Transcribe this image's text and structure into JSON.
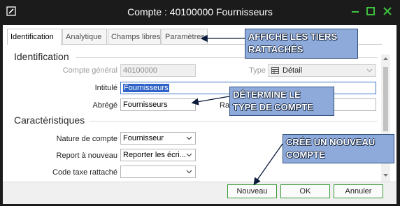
{
  "window": {
    "title": "Compte : 40100000 Fournisseurs"
  },
  "tabs": [
    {
      "label": "Identification"
    },
    {
      "label": "Analytique"
    },
    {
      "label": "Champs libres"
    },
    {
      "label": "Paramètres"
    }
  ],
  "identification": {
    "section_title": "Identification",
    "compte_general_label": "Compte général",
    "compte_general_value": "40100000",
    "type_label": "Type",
    "type_value": "Détail",
    "intitule_label": "Intitulé",
    "intitule_value": "Fournisseurs",
    "abrege_label": "Abrégé",
    "abrege_value": "Fournisseurs",
    "ra_label": "Ra"
  },
  "caracteristiques": {
    "section_title": "Caractéristiques",
    "nature_label": "Nature de compte",
    "nature_value": "Fournisseur",
    "report_label": "Report à nouveau",
    "report_value": "Reporter les écri...",
    "code_taxe_label": "Code taxe rattaché",
    "code_taxe_value": ""
  },
  "buttons": {
    "nouveau": "Nouveau",
    "ok": "OK",
    "annuler": "Annuler"
  },
  "callouts": {
    "tiers": "AFFICHE LES TIERS\nRATTACHÉS",
    "type": "DÉTERMINE LE\nTYPE DE COMPTE",
    "nouveau": "CRÉE UN NOUVEAU\nCOMPTE"
  },
  "colors": {
    "callout_fill": "#8eaadb",
    "accent_green": "#3a9a3a",
    "selection": "#2f63c8"
  }
}
